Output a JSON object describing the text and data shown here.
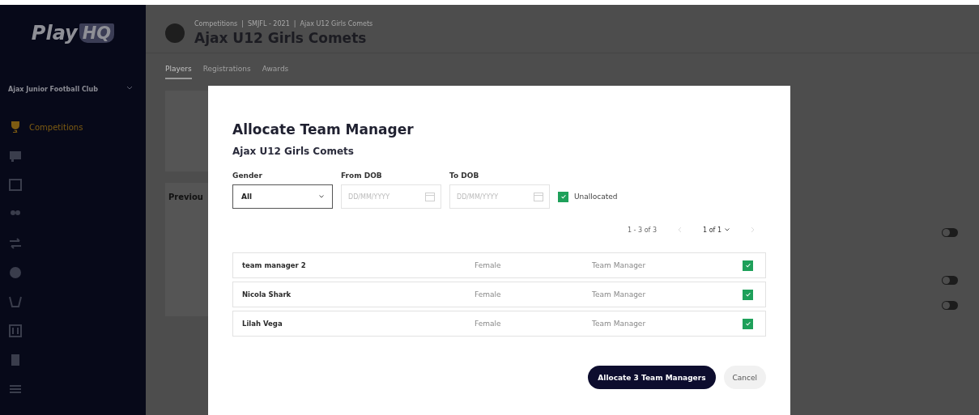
{
  "sidebar": {
    "logo": "Play",
    "logo_badge": "HQ",
    "organisation": "Ajax Junior Football Club",
    "items": [
      {
        "label": "Competitions",
        "selected": true
      }
    ]
  },
  "header": {
    "breadcrumbs": "Competitions  |  SMJFL - 2021  |  Ajax U12 Girls Comets",
    "title": "Ajax U12 Girls Comets"
  },
  "tabs": [
    {
      "label": "Players",
      "selected": true
    },
    {
      "label": "Registrations",
      "selected": false
    },
    {
      "label": "Awards",
      "selected": false
    }
  ],
  "background_panel": {
    "heading": "Previou"
  },
  "right_panel": {
    "toggles": [
      {
        "on": false
      },
      {
        "on": false
      },
      {
        "on": false
      }
    ]
  },
  "modal": {
    "title": "Allocate Team Manager",
    "subtitle": "Ajax U12 Girls Comets",
    "filters": {
      "gender": {
        "label": "Gender",
        "value": "All"
      },
      "from_dob": {
        "label": "From DOB",
        "placeholder": "DD/MM/YYYY"
      },
      "to_dob": {
        "label": "To DOB",
        "placeholder": "DD/MM/YYYY"
      },
      "unallocated": {
        "label": "Unallocated",
        "checked": true
      }
    },
    "pagination": {
      "range": "1 - 3 of 3",
      "page": "1 of 1"
    },
    "rows": [
      {
        "name": "team manager 2",
        "gender": "Female",
        "role": "Team Manager",
        "checked": true
      },
      {
        "name": "Nicola Shark",
        "gender": "Female",
        "role": "Team Manager",
        "checked": true
      },
      {
        "name": "Lilah Vega",
        "gender": "Female",
        "role": "Team Manager",
        "checked": true
      }
    ],
    "buttons": {
      "allocate": "Allocate 3 Team Managers",
      "cancel": "Cancel"
    }
  }
}
